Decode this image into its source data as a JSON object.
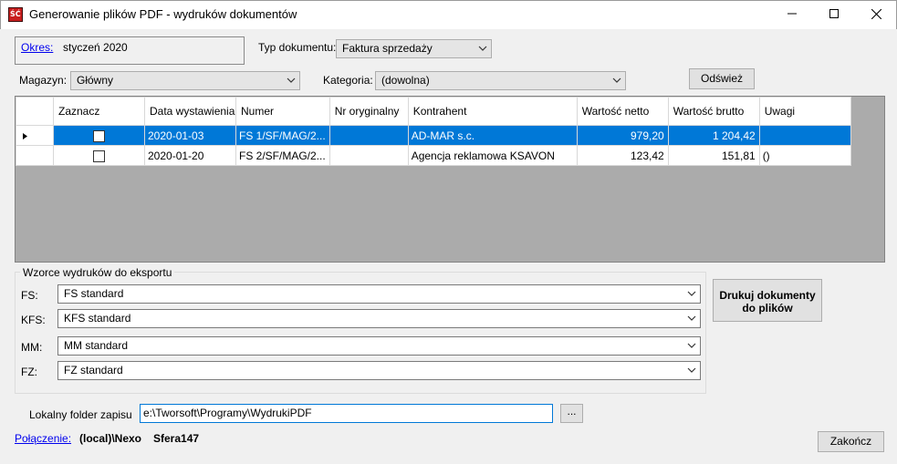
{
  "window": {
    "title": "Generowanie plików PDF - wydruków dokumentów",
    "icon": "app-logo-icon",
    "controls": [
      "minimize-icon",
      "maximize-icon",
      "close-icon"
    ]
  },
  "okres": {
    "label": "Okres:",
    "value": "styczeń 2020"
  },
  "typ_dokumentu": {
    "label": "Typ dokumentu:",
    "value": "Faktura sprzedaży"
  },
  "magazyn": {
    "label": "Magazyn:",
    "value": "Główny"
  },
  "kategoria": {
    "label": "Kategoria:",
    "value": "(dowolna)"
  },
  "refresh_label": "Odśwież",
  "grid": {
    "columns": [
      "Zaznacz",
      "Data wystawienia",
      "Numer",
      "Nr oryginalny",
      "Kontrahent",
      "Wartość netto",
      "Wartość brutto",
      "Uwagi"
    ],
    "rows": [
      {
        "checked": false,
        "date": "2020-01-03",
        "number": "FS 1/SF/MAG/2...",
        "orig": "",
        "contractor": "AD-MAR s.c.",
        "net": "979,20",
        "gross": "1 204,42",
        "notes": ""
      },
      {
        "checked": false,
        "date": "2020-01-20",
        "number": "FS 2/SF/MAG/2...",
        "orig": "",
        "contractor": "Agencja reklamowa KSAVON",
        "net": "123,42",
        "gross": "151,81",
        "notes": "()"
      }
    ],
    "selected_row": 0
  },
  "templates": {
    "title": "Wzorce wydruków do eksportu",
    "items": [
      {
        "label": "FS:",
        "value": "FS standard"
      },
      {
        "label": "KFS:",
        "value": "KFS standard"
      },
      {
        "label": "MM:",
        "value": "MM standard"
      },
      {
        "label": "FZ:",
        "value": "FZ standard"
      }
    ]
  },
  "print_button_label": "Drukuj dokumenty do plików",
  "folder": {
    "label": "Lokalny folder zapisu",
    "value": "e:\\Tworsoft\\Programy\\WydrukiPDF",
    "browse_label": "..."
  },
  "connection": {
    "label": "Połączenie:",
    "server": "(local)\\Nexo",
    "database": "Sfera147"
  },
  "close_label": "Zakończ",
  "colors": {
    "selection": "#0078d7",
    "grid_background": "#ababab",
    "link": "#0000ee"
  }
}
